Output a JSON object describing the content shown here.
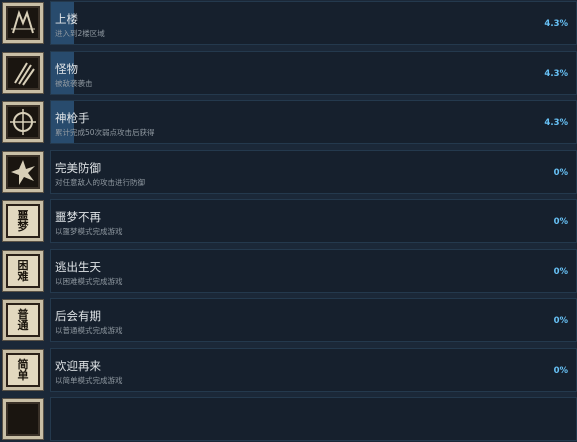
{
  "achievements": [
    {
      "title": "上楼",
      "desc": "进入到2楼区域",
      "percent": "4.3%",
      "fill": 0.043,
      "icon": "climb-icon"
    },
    {
      "title": "怪物",
      "desc": "被敌袭袭击",
      "percent": "4.3%",
      "fill": 0.043,
      "icon": "claw-scratch-icon"
    },
    {
      "title": "神枪手",
      "desc": "累计完成50次弱点攻击后获得",
      "percent": "4.3%",
      "fill": 0.043,
      "icon": "crosshair-icon"
    },
    {
      "title": "完美防御",
      "desc": "对任意敌人的攻击进行防御",
      "percent": "0%",
      "fill": 0,
      "icon": "shield-burst-icon"
    },
    {
      "title": "噩梦不再",
      "desc": "以噩梦模式完成游戏",
      "percent": "0%",
      "fill": 0,
      "icon": "nightmare-badge-icon",
      "badge": [
        "噩",
        "梦"
      ]
    },
    {
      "title": "逃出生天",
      "desc": "以困难模式完成游戏",
      "percent": "0%",
      "fill": 0,
      "icon": "hard-badge-icon",
      "badge": [
        "困",
        "难"
      ]
    },
    {
      "title": "后会有期",
      "desc": "以普通模式完成游戏",
      "percent": "0%",
      "fill": 0,
      "icon": "normal-badge-icon",
      "badge": [
        "普",
        "通"
      ]
    },
    {
      "title": "欢迎再来",
      "desc": "以简单模式完成游戏",
      "percent": "0%",
      "fill": 0,
      "icon": "easy-badge-icon",
      "badge": [
        "简",
        "单"
      ]
    }
  ]
}
